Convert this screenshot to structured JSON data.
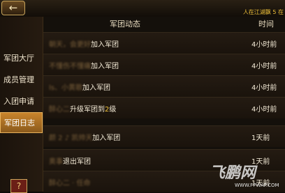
{
  "topbar": {
    "back_icon": "←",
    "marquee": "人在江湖飘 5 在"
  },
  "sidebar": {
    "items": [
      {
        "label": "军团大厅",
        "active": false
      },
      {
        "label": "成员管理",
        "active": false
      },
      {
        "label": "入团申请",
        "active": false
      },
      {
        "label": "军团日志",
        "active": true
      }
    ],
    "help": "?"
  },
  "table": {
    "headers": {
      "event": "军团动态",
      "time": "时间"
    },
    "rows": [
      {
        "name": "朝天，会更好",
        "action": "加入军团",
        "time": "4小时前"
      },
      {
        "name": "不懂伤不懂痛",
        "action": "加入军团",
        "time": "4小时前"
      },
      {
        "name": "ls、小黄歌",
        "action": "加入军团",
        "time": "4小时前"
      },
      {
        "name": "醉心二",
        "action": "升级军团到",
        "level": "2",
        "suffix": "级",
        "time": "4小时前"
      },
      {
        "name": "颜 2 ♪ 凯帅天",
        "action": "加入军团",
        "time": "1天前"
      },
      {
        "name": "奥事",
        "action": "退出军团",
        "time": "1天前"
      },
      {
        "name": "醉心二 · 任命",
        "action": "",
        "time": "1天前"
      }
    ]
  },
  "watermark": {
    "text": "飞鹏网",
    "url": "WWW.FPWAP.COM"
  }
}
